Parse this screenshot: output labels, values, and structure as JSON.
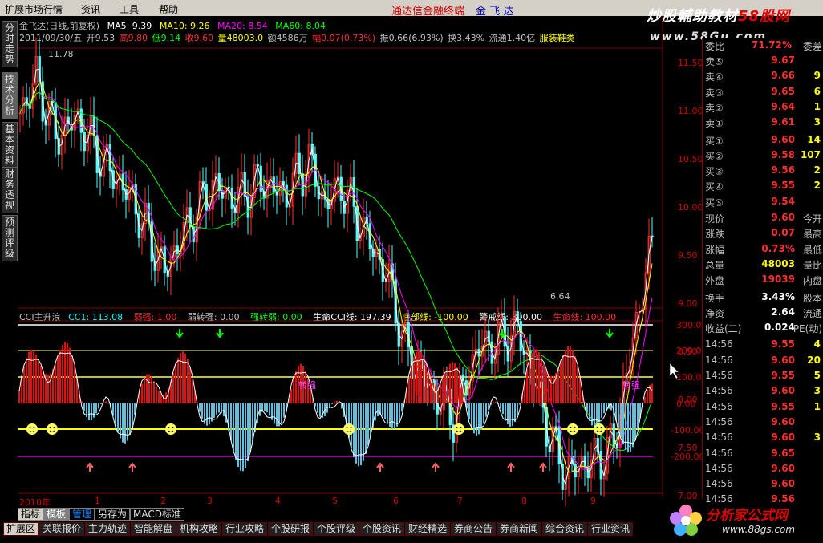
{
  "menu": [
    "扩展市场行情",
    "资讯",
    "工具",
    "帮助"
  ],
  "window_title": "通达信金融终端",
  "stock_name": "金 飞 达",
  "brand": {
    "line1a": "炒股輔助教材",
    "line1b": "58股网",
    "line2": "www.58Gu.com",
    "logo": "分析家公式网",
    "logo_url": "www.88gs.com"
  },
  "left_tabs": [
    "分时走势",
    "技术分析",
    "基本资料",
    "财务透视",
    "预测评级"
  ],
  "info1": {
    "name": "金飞达(日线,前复权)",
    "ma5": "MA5: 9.39",
    "ma10": "MA10: 9.26",
    "ma20": "MA20: 8.54",
    "ma60": "MA60: 8.04"
  },
  "info2": {
    "date": "2011/09/30/五",
    "open": "开9.53",
    "high": "高9.80",
    "low": "低9.14",
    "close": "收9.60",
    "vol": "量48003.0",
    "amt": "额4586万",
    "fu": "幅0.07(0.73%)",
    "zhen": "振0.66(6.93%)",
    "huan": "换3.43%",
    "liutong": "流通1.40亿",
    "sector": "服装鞋类"
  },
  "price_annotations": {
    "high": "11.78",
    "low": "6.64"
  },
  "indicator": {
    "name": "CCI主升浪",
    "cci1": "CC1: 113.08",
    "t1": "弱强: 1.00",
    "t2": "弱转强: 0.00",
    "t3": "强转弱: 0.00",
    "t4": "生命CCI线: 197.39",
    "t5": "底部线: -100.00",
    "t6": "警戒线: 300.00",
    "t7": "生命线: 100.00",
    "label_a": "转强",
    "label_b": "转强"
  },
  "price_axis": [
    "11.50",
    "11.00",
    "10.50",
    "10.00",
    "9.50",
    "9.00",
    "8.50",
    "8.00",
    "7.50",
    "7.00"
  ],
  "cci_axis": [
    "300.00",
    "200.00",
    "100.00",
    "0.00",
    "-100.00",
    "-200.00"
  ],
  "time_axis": [
    "2010年",
    "1",
    "2",
    "3",
    "4",
    "5",
    "6",
    "7",
    "8",
    "9"
  ],
  "quote": {
    "wei_bi": "委比",
    "wei_bi_v": "71.72%",
    "wei_cha": "委差",
    "sells": [
      {
        "l": "卖⑤",
        "p": "9.67",
        "q": ""
      },
      {
        "l": "卖④",
        "p": "9.66",
        "q": "9"
      },
      {
        "l": "卖③",
        "p": "9.65",
        "q": "6"
      },
      {
        "l": "卖②",
        "p": "9.64",
        "q": "1"
      },
      {
        "l": "卖①",
        "p": "9.61",
        "q": "3"
      }
    ],
    "buys": [
      {
        "l": "买①",
        "p": "9.60",
        "q": "14"
      },
      {
        "l": "买②",
        "p": "9.58",
        "q": "107"
      },
      {
        "l": "买③",
        "p": "9.56",
        "q": "2"
      },
      {
        "l": "买④",
        "p": "9.55",
        "q": "2"
      },
      {
        "l": "买⑤",
        "p": "9.54",
        "q": ""
      }
    ],
    "stats": [
      {
        "l": "现价",
        "v": "9.60",
        "r": "今开"
      },
      {
        "l": "涨跌",
        "v": "0.07",
        "r": "最高"
      },
      {
        "l": "涨幅",
        "v": "0.73%",
        "r": "最低"
      },
      {
        "l": "总量",
        "v": "48003",
        "r": "量比"
      },
      {
        "l": "外盘",
        "v": "19039",
        "r": "内盘"
      }
    ],
    "stats2": [
      {
        "l": "换手",
        "v": "3.43%",
        "r": "股本"
      },
      {
        "l": "净资",
        "v": "2.64",
        "r": "流通"
      },
      {
        "l": "收益(二)",
        "v": "0.024",
        "r": "PE(动)"
      }
    ],
    "ticks": [
      {
        "t": "14:56",
        "p": "9.55",
        "q": "4"
      },
      {
        "t": "14:56",
        "p": "9.60",
        "q": "20"
      },
      {
        "t": "14:56",
        "p": "9.55",
        "q": "5"
      },
      {
        "t": "14:56",
        "p": "9.60",
        "q": "3"
      },
      {
        "t": "14:56",
        "p": "9.55",
        "q": "1"
      },
      {
        "t": "14:56",
        "p": "9.60",
        "q": ""
      },
      {
        "t": "14:56",
        "p": "9.60",
        "q": "3"
      },
      {
        "t": "14:56",
        "p": "9.65",
        "q": ""
      },
      {
        "t": "14:56",
        "p": "9.60",
        "q": ""
      },
      {
        "t": "14:56",
        "p": "9.60",
        "q": ""
      },
      {
        "t": "14:56",
        "p": "9.56",
        "q": ""
      },
      {
        "t": "14:56",
        "p": "9.60",
        "q": ""
      }
    ]
  },
  "bottom_tabs1": [
    "指标",
    "模板",
    "管理",
    "另存为",
    "MACD标准"
  ],
  "bottom_tabs2": [
    "扩展区",
    "关联报价",
    "主力轨迹",
    "智能解盘",
    "机构攻略",
    "行业攻略",
    "个股研报",
    "个股评级",
    "个股资讯",
    "财经精选",
    "券商公告",
    "券商新闻",
    "综合资讯",
    "行业资讯"
  ],
  "colors": {
    "up": "#ff3030",
    "down": "#54ffff",
    "ma5": "#ffffff",
    "ma10": "#ffff00",
    "ma20": "#ff00ff",
    "ma60": "#00ff00"
  }
}
